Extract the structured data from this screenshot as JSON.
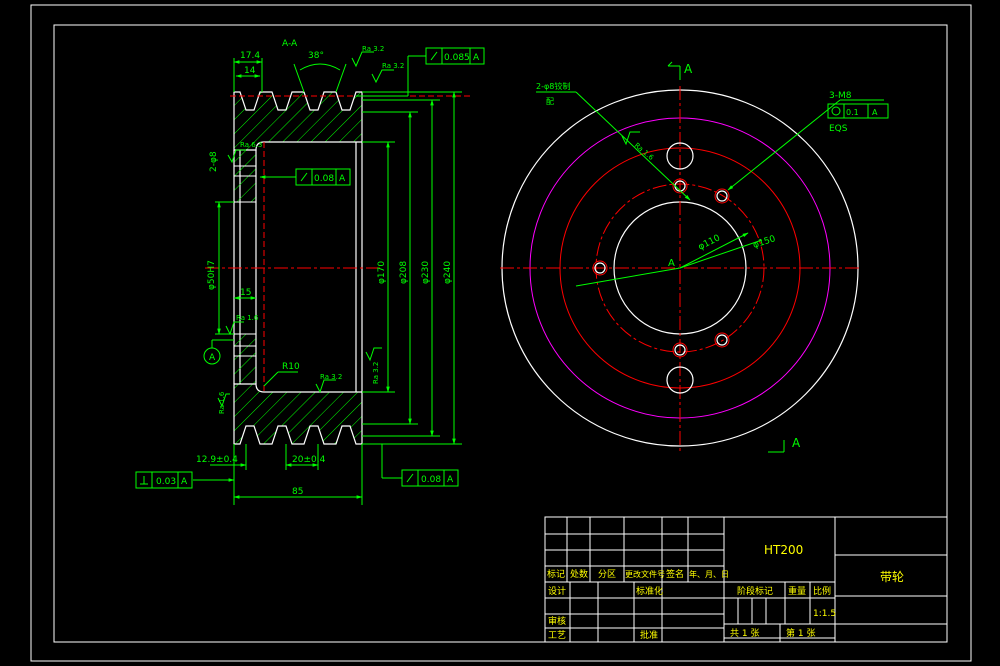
{
  "colors": {
    "background": "#000000",
    "frame": "#ffffff",
    "dimension": "#00ff00",
    "hatch": "#00ff00",
    "outline": "#ffffff",
    "centerline": "#ff0000",
    "hidden": "#ff0000",
    "pitch_circle": "#ff00ff",
    "symbol": "#00ff00",
    "table_text": "#ffff00"
  },
  "section_view": {
    "section_label": "A-A",
    "groove_angle": "38°",
    "width_17_4": "17.4",
    "width_14": "14",
    "ra_top_1": "Ra 3.2",
    "ra_top_2": "Ra 3.2",
    "runout_top_value": "0.085",
    "runout_top_datum": "A",
    "holes_label": "2-φ8",
    "ra_hole": "Ra 6.3",
    "runout_mid_value": "0.08",
    "runout_mid_datum": "A",
    "bore_dim": "φ50H7",
    "dim_15": "15",
    "ra_bore": "Ra 1.6",
    "datum_a": "A",
    "radius_label": "R10",
    "ra_r10": "Ra 3.2",
    "ra_side": "Ra 3.2",
    "ra_left": "Ra 1.6",
    "dia_170": "φ170",
    "dia_208": "φ208",
    "dia_230": "φ230",
    "dia_240": "φ240",
    "dim_12_9": "12.9±0.4",
    "dim_20": "20±0.4",
    "dim_85": "85",
    "perp_value": "0.03",
    "perp_datum": "A",
    "runout_bottom_value": "0.08",
    "runout_bottom_datum": "A"
  },
  "front_view": {
    "section_mark_top": "A",
    "section_mark_bottom": "A",
    "hole_label_line1": "2-φ8铰制",
    "hole_label_line2": "配",
    "tapped_label": "3-M8",
    "tapped_tol": "0.1",
    "tapped_datum": "A",
    "tapped_eqs": "EQS",
    "ra_hole": "Ra 1.6",
    "center_label": "A",
    "dia_110": "φ110",
    "dia_150": "φ150"
  },
  "title_block": {
    "material": "HT200",
    "part_name": "带轮",
    "headers": [
      "标记",
      "处数",
      "分区",
      "更改文件号",
      "签名",
      "年、月、日"
    ],
    "design": "设计",
    "standardize": "标准化",
    "review": "审核",
    "process": "工艺",
    "approve": "批准",
    "stage_mark": "阶段标记",
    "weight": "重量",
    "scale_label": "比例",
    "scale_value": "1:1.5",
    "total_sheets": "共 1 张",
    "sheet_no": "第 1 张"
  }
}
